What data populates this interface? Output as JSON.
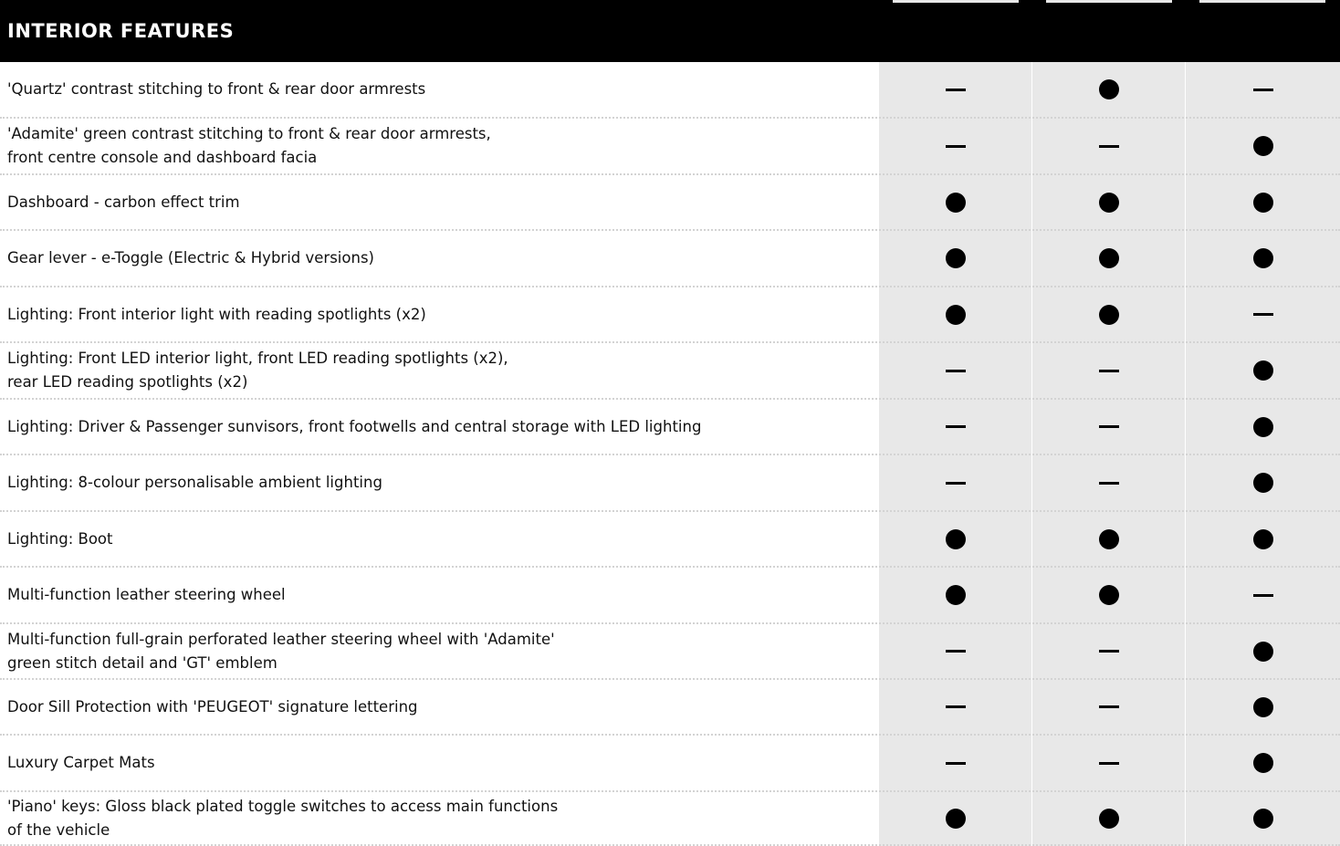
{
  "section": {
    "title": "INTERIOR FEATURES"
  },
  "symbols": {
    "standard": "●",
    "not_available": "—"
  },
  "rows": [
    {
      "label": "'Quartz' contrast stitching to front & rear door armrests",
      "values": [
        "no",
        "yes",
        "no"
      ]
    },
    {
      "label": "'Adamite' green contrast stitching to front & rear door armrests,\nfront centre console and dashboard facia",
      "values": [
        "no",
        "no",
        "yes"
      ]
    },
    {
      "label": "Dashboard - carbon effect trim",
      "values": [
        "yes",
        "yes",
        "yes"
      ]
    },
    {
      "label": "Gear lever - e-Toggle (Electric & Hybrid versions)",
      "values": [
        "yes",
        "yes",
        "yes"
      ]
    },
    {
      "label": "Lighting: Front interior light with reading spotlights (x2)",
      "values": [
        "yes",
        "yes",
        "no"
      ]
    },
    {
      "label": "Lighting: Front LED interior light, front LED reading spotlights (x2),\nrear LED reading spotlights (x2)",
      "values": [
        "no",
        "no",
        "yes"
      ]
    },
    {
      "label": "Lighting: Driver & Passenger sunvisors, front footwells and central storage with LED lighting",
      "values": [
        "no",
        "no",
        "yes"
      ]
    },
    {
      "label": "Lighting: 8-colour personalisable ambient lighting",
      "values": [
        "no",
        "no",
        "yes"
      ]
    },
    {
      "label": "Lighting: Boot",
      "values": [
        "yes",
        "yes",
        "yes"
      ]
    },
    {
      "label": "Multi-function leather steering wheel",
      "values": [
        "yes",
        "yes",
        "no"
      ]
    },
    {
      "label": "Multi-function full-grain perforated leather steering wheel with 'Adamite'\ngreen stitch detail and 'GT' emblem",
      "values": [
        "no",
        "no",
        "yes"
      ]
    },
    {
      "label": "Door Sill Protection with 'PEUGEOT' signature lettering",
      "values": [
        "no",
        "no",
        "yes"
      ]
    },
    {
      "label": "Luxury Carpet Mats",
      "values": [
        "no",
        "no",
        "yes"
      ]
    },
    {
      "label": "'Piano' keys: Gloss black plated toggle switches to access main functions\nof the vehicle",
      "values": [
        "yes",
        "yes",
        "yes"
      ]
    }
  ]
}
